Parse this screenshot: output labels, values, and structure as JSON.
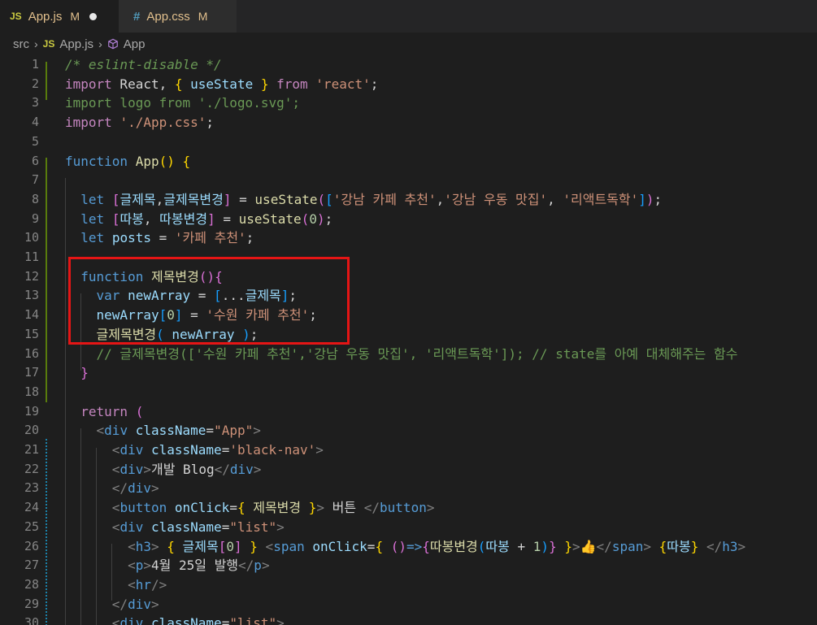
{
  "tabs": [
    {
      "badge": "JS",
      "name": "App.js",
      "modified": "M"
    },
    {
      "badge": "#",
      "name": "App.css",
      "modified": "M"
    }
  ],
  "breadcrumb": {
    "folder": "src",
    "file": "App.js",
    "symbol": "App"
  },
  "lines": [
    {
      "n": "1",
      "segs": [
        [
          "cmt",
          "/* eslint-disable */"
        ]
      ]
    },
    {
      "n": "2",
      "segs": [
        [
          "ctl",
          "import"
        ],
        [
          "txt",
          " React, "
        ],
        [
          "p1",
          "{"
        ],
        [
          "txt",
          " "
        ],
        [
          "var",
          "useState"
        ],
        [
          "txt",
          " "
        ],
        [
          "p1",
          "}"
        ],
        [
          "txt",
          " "
        ],
        [
          "ctl",
          "from"
        ],
        [
          "txt",
          " "
        ],
        [
          "str",
          "'react'"
        ],
        [
          "txt",
          ";"
        ]
      ]
    },
    {
      "n": "3",
      "segs": [
        [
          "cmt2",
          "import logo from './logo.svg';"
        ]
      ]
    },
    {
      "n": "4",
      "segs": [
        [
          "ctl",
          "import"
        ],
        [
          "txt",
          " "
        ],
        [
          "str",
          "'./App.css'"
        ],
        [
          "txt",
          ";"
        ]
      ]
    },
    {
      "n": "5",
      "segs": []
    },
    {
      "n": "6",
      "segs": [
        [
          "kw",
          "function"
        ],
        [
          "txt",
          " "
        ],
        [
          "fn",
          "App"
        ],
        [
          "p1",
          "()"
        ],
        [
          "txt",
          " "
        ],
        [
          "p1",
          "{"
        ]
      ]
    },
    {
      "n": "7",
      "segs": []
    },
    {
      "n": "8",
      "segs": [
        [
          "txt",
          "  "
        ],
        [
          "kw",
          "let"
        ],
        [
          "txt",
          " "
        ],
        [
          "p2",
          "["
        ],
        [
          "var",
          "글제목"
        ],
        [
          "txt",
          ","
        ],
        [
          "var",
          "글제목변경"
        ],
        [
          "p2",
          "]"
        ],
        [
          "txt",
          " = "
        ],
        [
          "fn",
          "useState"
        ],
        [
          "p2",
          "("
        ],
        [
          "p3",
          "["
        ],
        [
          "str",
          "'강남 카페 추천'"
        ],
        [
          "txt",
          ","
        ],
        [
          "str",
          "'강남 우동 맛집'"
        ],
        [
          "txt",
          ", "
        ],
        [
          "str",
          "'리액트독학'"
        ],
        [
          "p3",
          "]"
        ],
        [
          "p2",
          ")"
        ],
        [
          "txt",
          ";"
        ]
      ]
    },
    {
      "n": "9",
      "segs": [
        [
          "txt",
          "  "
        ],
        [
          "kw",
          "let"
        ],
        [
          "txt",
          " "
        ],
        [
          "p2",
          "["
        ],
        [
          "var",
          "따봉"
        ],
        [
          "txt",
          ", "
        ],
        [
          "var",
          "따봉변경"
        ],
        [
          "p2",
          "]"
        ],
        [
          "txt",
          " = "
        ],
        [
          "fn",
          "useState"
        ],
        [
          "p2",
          "("
        ],
        [
          "num",
          "0"
        ],
        [
          "p2",
          ")"
        ],
        [
          "txt",
          ";"
        ]
      ]
    },
    {
      "n": "10",
      "segs": [
        [
          "txt",
          "  "
        ],
        [
          "kw",
          "let"
        ],
        [
          "txt",
          " "
        ],
        [
          "var",
          "posts"
        ],
        [
          "txt",
          " = "
        ],
        [
          "str",
          "'카페 추천'"
        ],
        [
          "txt",
          ";"
        ]
      ]
    },
    {
      "n": "11",
      "segs": []
    },
    {
      "n": "12",
      "segs": [
        [
          "txt",
          "  "
        ],
        [
          "kw",
          "function"
        ],
        [
          "txt",
          " "
        ],
        [
          "fn",
          "제목변경"
        ],
        [
          "p2",
          "(){"
        ]
      ]
    },
    {
      "n": "13",
      "segs": [
        [
          "txt",
          "    "
        ],
        [
          "kw",
          "var"
        ],
        [
          "txt",
          " "
        ],
        [
          "var",
          "newArray"
        ],
        [
          "txt",
          " = "
        ],
        [
          "p3",
          "["
        ],
        [
          "txt",
          "..."
        ],
        [
          "var",
          "글제목"
        ],
        [
          "p3",
          "]"
        ],
        [
          "txt",
          ";"
        ]
      ]
    },
    {
      "n": "14",
      "segs": [
        [
          "txt",
          "    "
        ],
        [
          "var",
          "newArray"
        ],
        [
          "p3",
          "["
        ],
        [
          "num",
          "0"
        ],
        [
          "p3",
          "]"
        ],
        [
          "txt",
          " = "
        ],
        [
          "str",
          "'수원 카페 추천'"
        ],
        [
          "txt",
          ";"
        ]
      ]
    },
    {
      "n": "15",
      "segs": [
        [
          "txt",
          "    "
        ],
        [
          "fn",
          "글제목변경"
        ],
        [
          "p3",
          "("
        ],
        [
          "txt",
          " "
        ],
        [
          "var",
          "newArray"
        ],
        [
          "txt",
          " "
        ],
        [
          "p3",
          ")"
        ],
        [
          "txt",
          ";"
        ]
      ]
    },
    {
      "n": "16",
      "segs": [
        [
          "txt",
          "    "
        ],
        [
          "cmt2",
          "// 글제목변경(['수원 카페 추천','강남 우동 맛집', '리액트독학']); // state를 아예 대체해주는 함수"
        ]
      ]
    },
    {
      "n": "17",
      "segs": [
        [
          "txt",
          "  "
        ],
        [
          "p2",
          "}"
        ]
      ]
    },
    {
      "n": "18",
      "segs": []
    },
    {
      "n": "19",
      "segs": [
        [
          "txt",
          "  "
        ],
        [
          "ctl",
          "return"
        ],
        [
          "txt",
          " "
        ],
        [
          "p2",
          "("
        ]
      ]
    },
    {
      "n": "20",
      "segs": [
        [
          "txt",
          "    "
        ],
        [
          "br",
          "<"
        ],
        [
          "tag",
          "div"
        ],
        [
          "txt",
          " "
        ],
        [
          "attr",
          "className"
        ],
        [
          "txt",
          "="
        ],
        [
          "str",
          "\"App\""
        ],
        [
          "br",
          ">"
        ]
      ]
    },
    {
      "n": "21",
      "segs": [
        [
          "txt",
          "      "
        ],
        [
          "br",
          "<"
        ],
        [
          "tag",
          "div"
        ],
        [
          "txt",
          " "
        ],
        [
          "attr",
          "className"
        ],
        [
          "txt",
          "="
        ],
        [
          "str",
          "'black-nav'"
        ],
        [
          "br",
          ">"
        ]
      ]
    },
    {
      "n": "22",
      "segs": [
        [
          "txt",
          "      "
        ],
        [
          "br",
          "<"
        ],
        [
          "tag",
          "div"
        ],
        [
          "br",
          ">"
        ],
        [
          "txt",
          "개발 Blog"
        ],
        [
          "br",
          "</"
        ],
        [
          "tag",
          "div"
        ],
        [
          "br",
          ">"
        ]
      ]
    },
    {
      "n": "23",
      "segs": [
        [
          "txt",
          "      "
        ],
        [
          "br",
          "</"
        ],
        [
          "tag",
          "div"
        ],
        [
          "br",
          ">"
        ]
      ]
    },
    {
      "n": "24",
      "segs": [
        [
          "txt",
          "      "
        ],
        [
          "br",
          "<"
        ],
        [
          "tag",
          "button"
        ],
        [
          "txt",
          " "
        ],
        [
          "attr",
          "onClick"
        ],
        [
          "txt",
          "="
        ],
        [
          "p1",
          "{"
        ],
        [
          "txt",
          " "
        ],
        [
          "fn",
          "제목변경"
        ],
        [
          "txt",
          " "
        ],
        [
          "p1",
          "}"
        ],
        [
          "br",
          ">"
        ],
        [
          "txt",
          " 버튼 "
        ],
        [
          "br",
          "</"
        ],
        [
          "tag",
          "button"
        ],
        [
          "br",
          ">"
        ]
      ]
    },
    {
      "n": "25",
      "segs": [
        [
          "txt",
          "      "
        ],
        [
          "br",
          "<"
        ],
        [
          "tag",
          "div"
        ],
        [
          "txt",
          " "
        ],
        [
          "attr",
          "className"
        ],
        [
          "txt",
          "="
        ],
        [
          "str",
          "\"list\""
        ],
        [
          "br",
          ">"
        ]
      ]
    },
    {
      "n": "26",
      "segs": [
        [
          "txt",
          "        "
        ],
        [
          "br",
          "<"
        ],
        [
          "tag",
          "h3"
        ],
        [
          "br",
          ">"
        ],
        [
          "txt",
          " "
        ],
        [
          "p1",
          "{"
        ],
        [
          "txt",
          " "
        ],
        [
          "var",
          "글제목"
        ],
        [
          "p2",
          "["
        ],
        [
          "num",
          "0"
        ],
        [
          "p2",
          "]"
        ],
        [
          "txt",
          " "
        ],
        [
          "p1",
          "}"
        ],
        [
          "txt",
          " "
        ],
        [
          "br",
          "<"
        ],
        [
          "tag",
          "span"
        ],
        [
          "txt",
          " "
        ],
        [
          "attr",
          "onClick"
        ],
        [
          "txt",
          "="
        ],
        [
          "p1",
          "{"
        ],
        [
          "txt",
          " "
        ],
        [
          "p2",
          "()"
        ],
        [
          "kw",
          "=>"
        ],
        [
          "p2",
          "{"
        ],
        [
          "fn",
          "따봉변경"
        ],
        [
          "p3",
          "("
        ],
        [
          "var",
          "따봉"
        ],
        [
          "txt",
          " + "
        ],
        [
          "num",
          "1"
        ],
        [
          "p3",
          ")"
        ],
        [
          "p2",
          "}"
        ],
        [
          "txt",
          " "
        ],
        [
          "p1",
          "}"
        ],
        [
          "br",
          ">"
        ],
        [
          "txt",
          "👍"
        ],
        [
          "br",
          "</"
        ],
        [
          "tag",
          "span"
        ],
        [
          "br",
          ">"
        ],
        [
          "txt",
          " "
        ],
        [
          "p1",
          "{"
        ],
        [
          "var",
          "따봉"
        ],
        [
          "p1",
          "}"
        ],
        [
          "txt",
          " "
        ],
        [
          "br",
          "</"
        ],
        [
          "tag",
          "h3"
        ],
        [
          "br",
          ">"
        ]
      ]
    },
    {
      "n": "27",
      "segs": [
        [
          "txt",
          "        "
        ],
        [
          "br",
          "<"
        ],
        [
          "tag",
          "p"
        ],
        [
          "br",
          ">"
        ],
        [
          "txt",
          "4월 25일 발행"
        ],
        [
          "br",
          "</"
        ],
        [
          "tag",
          "p"
        ],
        [
          "br",
          ">"
        ]
      ]
    },
    {
      "n": "28",
      "segs": [
        [
          "txt",
          "        "
        ],
        [
          "br",
          "<"
        ],
        [
          "tag",
          "hr"
        ],
        [
          "br",
          "/>"
        ]
      ]
    },
    {
      "n": "29",
      "segs": [
        [
          "txt",
          "      "
        ],
        [
          "br",
          "</"
        ],
        [
          "tag",
          "div"
        ],
        [
          "br",
          ">"
        ]
      ]
    },
    {
      "n": "30",
      "segs": [
        [
          "txt",
          "      "
        ],
        [
          "br",
          "<"
        ],
        [
          "tag",
          "div"
        ],
        [
          "txt",
          " "
        ],
        [
          "attr",
          "className"
        ],
        [
          "txt",
          "="
        ],
        [
          "str",
          "\"list\""
        ],
        [
          "br",
          ">"
        ]
      ]
    }
  ]
}
